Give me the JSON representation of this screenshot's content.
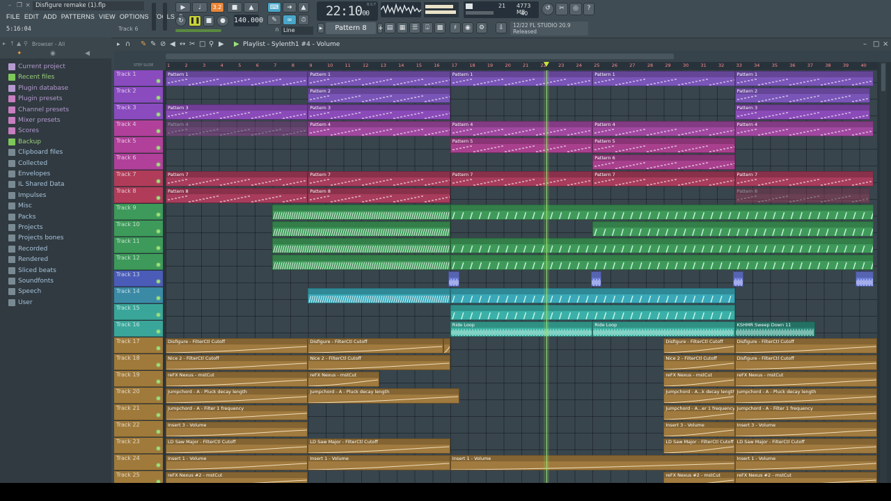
{
  "window": {
    "project_file": "Disfigure remake (1).flp",
    "menu": [
      "FILE",
      "EDIT",
      "ADD",
      "PATTERNS",
      "VIEW",
      "OPTIONS",
      "TOOLS",
      "?"
    ],
    "hint_time": "5:16:04",
    "hint_track": "Track 6"
  },
  "transport": {
    "tempo": "140.000",
    "clock_main": "22:10",
    "clock_sub": "00",
    "clock_label": "B:S:T",
    "pattern_selector": "Pattern 8",
    "snap": "Line",
    "cpu_count": "21",
    "memory": "4773 MB",
    "polyphony": "40",
    "rec_label": "3.2"
  },
  "news": {
    "line1": "12/22  FL STUDIO 20.9",
    "line2": "Released"
  },
  "browser": {
    "title": "Browser - All",
    "items": [
      {
        "label": "Current project",
        "color": "violet",
        "icon_color": "#b59ad0"
      },
      {
        "label": "Recent files",
        "color": "green",
        "icon_color": "#7ec85a"
      },
      {
        "label": "Plugin database",
        "color": "violet",
        "icon_color": "#b59ad0"
      },
      {
        "label": "Plugin presets",
        "color": "violet",
        "icon_color": "#c77fc0"
      },
      {
        "label": "Channel presets",
        "color": "violet",
        "icon_color": "#c77fc0"
      },
      {
        "label": "Mixer presets",
        "color": "violet",
        "icon_color": "#c77fc0"
      },
      {
        "label": "Scores",
        "color": "violet",
        "icon_color": "#c77fc0"
      },
      {
        "label": "Backup",
        "color": "green",
        "icon_color": "#7ec85a"
      },
      {
        "label": "Clipboard files",
        "color": "blue",
        "icon_color": "#7a8a93"
      },
      {
        "label": "Collected",
        "color": "blue",
        "icon_color": "#7a8a93"
      },
      {
        "label": "Envelopes",
        "color": "blue",
        "icon_color": "#7a8a93"
      },
      {
        "label": "IL Shared Data",
        "color": "blue",
        "icon_color": "#7a8a93"
      },
      {
        "label": "Impulses",
        "color": "blue",
        "icon_color": "#7a8a93"
      },
      {
        "label": "Misc",
        "color": "blue",
        "icon_color": "#7a8a93"
      },
      {
        "label": "Packs",
        "color": "blue",
        "icon_color": "#7a8a93"
      },
      {
        "label": "Projects",
        "color": "blue",
        "icon_color": "#7a8a93"
      },
      {
        "label": "Projects bones",
        "color": "blue",
        "icon_color": "#7a8a93"
      },
      {
        "label": "Recorded",
        "color": "blue",
        "icon_color": "#7a8a93"
      },
      {
        "label": "Rendered",
        "color": "blue",
        "icon_color": "#7a8a93"
      },
      {
        "label": "Sliced beats",
        "color": "blue",
        "icon_color": "#7a8a93"
      },
      {
        "label": "Soundfonts",
        "color": "blue",
        "icon_color": "#7a8a93"
      },
      {
        "label": "Speech",
        "color": "blue",
        "icon_color": "#7a8a93"
      },
      {
        "label": "User",
        "color": "blue",
        "icon_color": "#7a8a93"
      }
    ]
  },
  "playlist": {
    "title": "Playlist - Sylenth1 #4 - Volume",
    "bars": [
      "1",
      "2",
      "3",
      "4",
      "5",
      "6",
      "7",
      "8",
      "9",
      "10",
      "11",
      "12",
      "13",
      "14",
      "15",
      "16",
      "17",
      "18",
      "19",
      "20",
      "21",
      "22",
      "23",
      "24",
      "25",
      "26",
      "27",
      "28",
      "29",
      "30",
      "31",
      "32",
      "33",
      "34",
      "35",
      "36",
      "37",
      "38",
      "39",
      "40"
    ],
    "playhead_bar": 22.4,
    "tracks": [
      {
        "label": "Track 1",
        "color": "#8a4bbf"
      },
      {
        "label": "Track 2",
        "color": "#8a4bbf"
      },
      {
        "label": "Track 3",
        "color": "#8a4bbf"
      },
      {
        "label": "Track 4",
        "color": "#b0409a"
      },
      {
        "label": "Track 5",
        "color": "#b0409a"
      },
      {
        "label": "Track 6",
        "color": "#b0409a"
      },
      {
        "label": "Track 7",
        "color": "#b03c5a"
      },
      {
        "label": "Track 8",
        "color": "#b03c5a"
      },
      {
        "label": "Track 9",
        "color": "#3d9a5a"
      },
      {
        "label": "Track 10",
        "color": "#3d9a5a"
      },
      {
        "label": "Track 11",
        "color": "#3d9a5a"
      },
      {
        "label": "Track 12",
        "color": "#3d9a5a"
      },
      {
        "label": "Track 13",
        "color": "#4a5cb8"
      },
      {
        "label": "Track 14",
        "color": "#3a8aa6"
      },
      {
        "label": "Track 15",
        "color": "#3aa69a"
      },
      {
        "label": "Track 16",
        "color": "#3aa69a"
      },
      {
        "label": "Track 17",
        "color": "#a07a3a"
      },
      {
        "label": "Track 18",
        "color": "#a07a3a"
      },
      {
        "label": "Track 19",
        "color": "#a07a3a"
      },
      {
        "label": "Track 20",
        "color": "#a07a3a"
      },
      {
        "label": "Track 21",
        "color": "#a07a3a"
      },
      {
        "label": "Track 22",
        "color": "#a07a3a"
      },
      {
        "label": "Track 23",
        "color": "#a07a3a"
      },
      {
        "label": "Track 24",
        "color": "#a07a3a"
      },
      {
        "label": "Track 25",
        "color": "#a07a3a"
      }
    ],
    "clips": [
      {
        "track": 0,
        "start": 1,
        "end": 9,
        "label": "Pattern 1",
        "kind": "pattern",
        "color": "#7a55b8"
      },
      {
        "track": 0,
        "start": 9,
        "end": 17,
        "label": "Pattern 1",
        "kind": "pattern",
        "color": "#7a55b8"
      },
      {
        "track": 0,
        "start": 17,
        "end": 25,
        "label": "Pattern 1",
        "kind": "pattern",
        "color": "#7a55b8"
      },
      {
        "track": 0,
        "start": 25,
        "end": 33,
        "label": "Pattern 1",
        "kind": "pattern",
        "color": "#7a55b8"
      },
      {
        "track": 0,
        "start": 33,
        "end": 40.8,
        "label": "Pattern 1",
        "kind": "pattern",
        "color": "#7a55b8"
      },
      {
        "track": 1,
        "start": 9,
        "end": 17,
        "label": "Pattern 2",
        "kind": "pattern",
        "color": "#7a55b8"
      },
      {
        "track": 1,
        "start": 33,
        "end": 40.6,
        "label": "Pattern 2",
        "kind": "pattern",
        "color": "#7a55b8"
      },
      {
        "track": 2,
        "start": 1,
        "end": 9,
        "label": "Pattern 3",
        "kind": "pattern",
        "color": "#8a4bb8"
      },
      {
        "track": 2,
        "start": 9,
        "end": 17,
        "label": "Pattern 3",
        "kind": "pattern",
        "color": "#8a4bb8"
      },
      {
        "track": 2,
        "start": 33,
        "end": 40.6,
        "label": "Pattern 3",
        "kind": "pattern",
        "color": "#8a4bb8"
      },
      {
        "track": 3,
        "start": 1,
        "end": 9,
        "label": "Pattern 4",
        "kind": "pattern-muted",
        "color": "#a048a0"
      },
      {
        "track": 3,
        "start": 9,
        "end": 17,
        "label": "Pattern 4",
        "kind": "pattern",
        "color": "#a048a0"
      },
      {
        "track": 3,
        "start": 17,
        "end": 25,
        "label": "Pattern 4",
        "kind": "pattern",
        "color": "#a048a0"
      },
      {
        "track": 3,
        "start": 25,
        "end": 33,
        "label": "Pattern 4",
        "kind": "pattern",
        "color": "#a048a0"
      },
      {
        "track": 3,
        "start": 33,
        "end": 40.8,
        "label": "Pattern 4",
        "kind": "pattern",
        "color": "#a048a0"
      },
      {
        "track": 4,
        "start": 17,
        "end": 25,
        "label": "Pattern 5",
        "kind": "pattern",
        "color": "#a8408e"
      },
      {
        "track": 4,
        "start": 25,
        "end": 33,
        "label": "Pattern 5",
        "kind": "pattern",
        "color": "#a8408e"
      },
      {
        "track": 5,
        "start": 25,
        "end": 33,
        "label": "Pattern 6",
        "kind": "pattern",
        "color": "#a8408e"
      },
      {
        "track": 6,
        "start": 1,
        "end": 9,
        "label": "Pattern 7",
        "kind": "pattern",
        "color": "#a83c5c"
      },
      {
        "track": 6,
        "start": 9,
        "end": 17,
        "label": "Pattern 7",
        "kind": "pattern",
        "color": "#a83c5c"
      },
      {
        "track": 6,
        "start": 17,
        "end": 25,
        "label": "Pattern 7",
        "kind": "pattern",
        "color": "#a83c5c"
      },
      {
        "track": 6,
        "start": 25,
        "end": 33,
        "label": "Pattern 7",
        "kind": "pattern",
        "color": "#a83c5c"
      },
      {
        "track": 6,
        "start": 33,
        "end": 40.8,
        "label": "Pattern 7",
        "kind": "pattern",
        "color": "#a83c5c"
      },
      {
        "track": 7,
        "start": 1,
        "end": 9,
        "label": "Pattern 8",
        "kind": "pattern",
        "color": "#a83c5c"
      },
      {
        "track": 7,
        "start": 9,
        "end": 17,
        "label": "Pattern 8",
        "kind": "pattern",
        "color": "#a83c5c"
      },
      {
        "track": 7,
        "start": 33,
        "end": 40.6,
        "label": "Pattern 8",
        "kind": "pattern-muted",
        "color": "#a83c5c"
      },
      {
        "track": 8,
        "start": 7,
        "end": 17,
        "label": "",
        "kind": "audio-green",
        "color": "#3f9a5a"
      },
      {
        "track": 8,
        "start": 17,
        "end": 40.8,
        "label": "",
        "kind": "audio-green-sparse",
        "color": "#3f9a5a"
      },
      {
        "track": 9,
        "start": 7,
        "end": 17,
        "label": "",
        "kind": "audio-green",
        "color": "#3f9a5a"
      },
      {
        "track": 9,
        "start": 25,
        "end": 40.8,
        "label": "",
        "kind": "audio-green-sparse",
        "color": "#3f9a5a"
      },
      {
        "track": 10,
        "start": 7,
        "end": 17,
        "label": "",
        "kind": "audio-green",
        "color": "#3f9a5a"
      },
      {
        "track": 10,
        "start": 17,
        "end": 40.8,
        "label": "",
        "kind": "audio-green-sparse",
        "color": "#3f9a5a"
      },
      {
        "track": 11,
        "start": 7,
        "end": 17,
        "label": "",
        "kind": "audio-green",
        "color": "#3f9a5a"
      },
      {
        "track": 11,
        "start": 17,
        "end": 40.8,
        "label": "",
        "kind": "audio-green-sparse",
        "color": "#3f9a5a"
      },
      {
        "track": 12,
        "start": 16.9,
        "end": 17.5,
        "label": "",
        "kind": "audio-blue",
        "color": "#6a7ad8"
      },
      {
        "track": 12,
        "start": 24.9,
        "end": 25.5,
        "label": "",
        "kind": "audio-blue",
        "color": "#6a7ad8"
      },
      {
        "track": 12,
        "start": 32.9,
        "end": 33.5,
        "label": "",
        "kind": "audio-blue",
        "color": "#6a7ad8"
      },
      {
        "track": 12,
        "start": 39.8,
        "end": 40.8,
        "label": "",
        "kind": "audio-blue",
        "color": "#6a7ad8"
      },
      {
        "track": 13,
        "start": 9,
        "end": 17,
        "label": "",
        "kind": "audio-cyan-dense",
        "color": "#3aa8b8"
      },
      {
        "track": 13,
        "start": 17,
        "end": 33,
        "label": "",
        "kind": "audio-cyan-sparse",
        "color": "#3aa8b8"
      },
      {
        "track": 14,
        "start": 17,
        "end": 33,
        "label": "",
        "kind": "audio-teal-sparse",
        "color": "#3ab0a8"
      },
      {
        "track": 15,
        "start": 17,
        "end": 25,
        "label": "Ride Loop",
        "kind": "audio-teal",
        "color": "#3ab0a0"
      },
      {
        "track": 15,
        "start": 25,
        "end": 33,
        "label": "Ride Loop",
        "kind": "audio-teal",
        "color": "#3ab0a0"
      },
      {
        "track": 15,
        "start": 33,
        "end": 37.5,
        "label": "KSHMR Sweep Down 11",
        "kind": "audio-teal",
        "color": "#2d8a7a"
      },
      {
        "track": 16,
        "start": 1,
        "end": 9,
        "label": "Disfigure - FilterCtl Cutoff",
        "kind": "auto",
        "color": "#a07a3e"
      },
      {
        "track": 16,
        "start": 9,
        "end": 16.6,
        "label": "Disfigure - FilterCtl Cutoff",
        "kind": "auto",
        "color": "#a07a3e"
      },
      {
        "track": 16,
        "start": 16.6,
        "end": 17,
        "label": "",
        "kind": "auto",
        "color": "#a07a3e"
      },
      {
        "track": 16,
        "start": 29,
        "end": 33,
        "label": "Disfigure - FilterCtl Cutoff",
        "kind": "auto",
        "color": "#a07a3e"
      },
      {
        "track": 16,
        "start": 33,
        "end": 41,
        "label": "Disfigure - FilterCtl Cutoff",
        "kind": "auto",
        "color": "#a07a3e"
      },
      {
        "track": 17,
        "start": 1,
        "end": 9,
        "label": "Nice 2 - FilterCtl Cutoff",
        "kind": "auto",
        "color": "#a07a3e"
      },
      {
        "track": 17,
        "start": 9,
        "end": 17,
        "label": "Nice 2 - FilterCtl Cutoff",
        "kind": "auto",
        "color": "#a07a3e"
      },
      {
        "track": 17,
        "start": 29,
        "end": 33,
        "label": "Nice 2 - FilterCtl Cutoff",
        "kind": "auto",
        "color": "#a07a3e"
      },
      {
        "track": 17,
        "start": 33,
        "end": 41,
        "label": "Disfigure - FilterCtl Cutoff",
        "kind": "auto",
        "color": "#a07a3e"
      },
      {
        "track": 18,
        "start": 1,
        "end": 9,
        "label": "reFX Nexus - mstCut",
        "kind": "auto",
        "color": "#a07a3e"
      },
      {
        "track": 18,
        "start": 9,
        "end": 13,
        "label": "reFX Nexus - mstCut",
        "kind": "auto",
        "color": "#a07a3e"
      },
      {
        "track": 18,
        "start": 29,
        "end": 33,
        "label": "reFX Nexus - mstCut",
        "kind": "auto",
        "color": "#a07a3e"
      },
      {
        "track": 18,
        "start": 33,
        "end": 41,
        "label": "reFX Nexus - mstCut",
        "kind": "auto",
        "color": "#a07a3e"
      },
      {
        "track": 19,
        "start": 1,
        "end": 9,
        "label": "Jumpchord - A - Pluck decay length",
        "kind": "auto",
        "color": "#a07a3e"
      },
      {
        "track": 19,
        "start": 9,
        "end": 17.5,
        "label": "Jumpchord - A - Pluck decay length",
        "kind": "auto",
        "color": "#a07a3e"
      },
      {
        "track": 19,
        "start": 29,
        "end": 33,
        "label": "Jumpchord - A...k decay length",
        "kind": "auto",
        "color": "#a07a3e"
      },
      {
        "track": 19,
        "start": 33,
        "end": 41,
        "label": "Jumpchord - A - Pluck decay length",
        "kind": "auto",
        "color": "#a07a3e"
      },
      {
        "track": 20,
        "start": 1,
        "end": 9,
        "label": "Jumpchord - A - Filter 1 frequency",
        "kind": "auto",
        "color": "#a07a3e"
      },
      {
        "track": 20,
        "start": 29,
        "end": 33,
        "label": "Jumpchord - A...er 1 frequency",
        "kind": "auto",
        "color": "#a07a3e"
      },
      {
        "track": 20,
        "start": 33,
        "end": 41,
        "label": "Jumpchord - A - Filter 1 frequency",
        "kind": "auto",
        "color": "#a07a3e"
      },
      {
        "track": 21,
        "start": 1,
        "end": 9,
        "label": "Insert 3 - Volume",
        "kind": "auto",
        "color": "#a07a3e"
      },
      {
        "track": 21,
        "start": 29,
        "end": 33,
        "label": "Insert 3 - Volume",
        "kind": "auto",
        "color": "#a07a3e"
      },
      {
        "track": 21,
        "start": 33,
        "end": 41,
        "label": "Insert 3 - Volume",
        "kind": "auto",
        "color": "#a07a3e"
      },
      {
        "track": 22,
        "start": 1,
        "end": 9,
        "label": "LD Saw Major - FilterCtl Cutoff",
        "kind": "auto",
        "color": "#a07a3e"
      },
      {
        "track": 22,
        "start": 9,
        "end": 17,
        "label": "LD Saw Major - FilterCtl Cutoff",
        "kind": "auto",
        "color": "#a07a3e"
      },
      {
        "track": 22,
        "start": 29,
        "end": 33,
        "label": "LD Saw Major - FilterCtl Cutoff",
        "kind": "auto",
        "color": "#a07a3e"
      },
      {
        "track": 22,
        "start": 33,
        "end": 41,
        "label": "LD Saw Major - FilterCtl Cutoff",
        "kind": "auto",
        "color": "#a07a3e"
      },
      {
        "track": 23,
        "start": 1,
        "end": 9,
        "label": "Insert 1 - Volume",
        "kind": "auto",
        "color": "#a07a3e"
      },
      {
        "track": 23,
        "start": 9,
        "end": 17,
        "label": "Insert 1 - Volume",
        "kind": "auto",
        "color": "#a07a3e"
      },
      {
        "track": 23,
        "start": 17,
        "end": 33,
        "label": "Insert 1 - Volume",
        "kind": "auto",
        "color": "#a07a3e"
      },
      {
        "track": 23,
        "start": 33,
        "end": 41,
        "label": "Insert 1 - Volume",
        "kind": "auto",
        "color": "#a07a3e"
      },
      {
        "track": 24,
        "start": 1,
        "end": 9,
        "label": "reFX Nexus #2 - mstCut",
        "kind": "auto",
        "color": "#a07a3e"
      },
      {
        "track": 24,
        "start": 29,
        "end": 33,
        "label": "reFX Nexus #2 - mstCut",
        "kind": "auto",
        "color": "#a07a3e"
      },
      {
        "track": 24,
        "start": 33,
        "end": 41,
        "label": "reFX Nexus #2 - mstCut",
        "kind": "auto",
        "color": "#a07a3e"
      }
    ]
  }
}
